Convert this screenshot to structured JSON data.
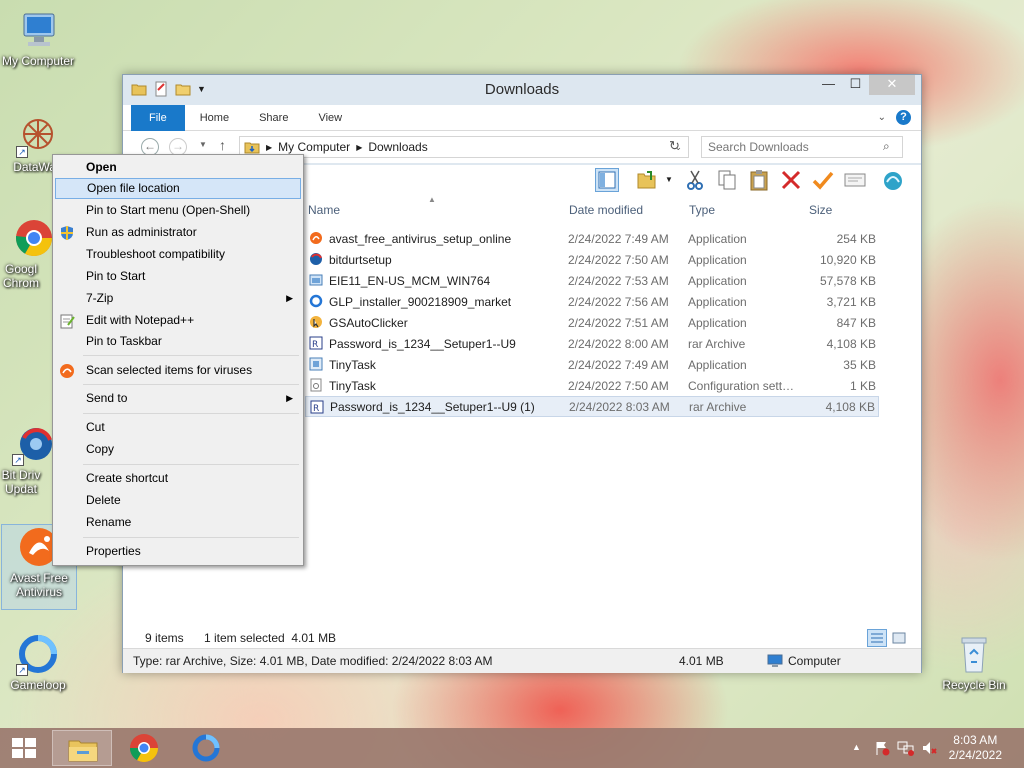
{
  "desktop": {
    "icons": [
      {
        "label": "My Computer"
      },
      {
        "label": "DataWag"
      },
      {
        "label": "Googl Chrom"
      },
      {
        "label": "Bit Driv Updat"
      },
      {
        "label": "Avast Free Antivirus"
      },
      {
        "label": "Gameloop"
      },
      {
        "label": "Recycle Bin"
      }
    ]
  },
  "window": {
    "title": "Downloads",
    "ribbon_tabs": [
      "File",
      "Home",
      "Share",
      "View"
    ],
    "address": {
      "crumbs": [
        "My Computer",
        "Downloads"
      ]
    },
    "search_placeholder": "Search Downloads",
    "columns": {
      "name": "Name",
      "date": "Date modified",
      "type": "Type",
      "size": "Size"
    },
    "files": [
      {
        "name": "avast_free_antivirus_setup_online",
        "date": "2/24/2022 7:49 AM",
        "type": "Application",
        "size": "254 KB"
      },
      {
        "name": "bitdurtsetup",
        "date": "2/24/2022 7:50 AM",
        "type": "Application",
        "size": "10,920 KB"
      },
      {
        "name": "EIE11_EN-US_MCM_WIN764",
        "date": "2/24/2022 7:53 AM",
        "type": "Application",
        "size": "57,578 KB"
      },
      {
        "name": "GLP_installer_900218909_market",
        "date": "2/24/2022 7:56 AM",
        "type": "Application",
        "size": "3,721 KB"
      },
      {
        "name": "GSAutoClicker",
        "date": "2/24/2022 7:51 AM",
        "type": "Application",
        "size": "847 KB"
      },
      {
        "name": "Password_is_1234__Setuper1--U9",
        "date": "2/24/2022 8:00 AM",
        "type": "rar Archive",
        "size": "4,108 KB"
      },
      {
        "name": "TinyTask",
        "date": "2/24/2022 7:49 AM",
        "type": "Application",
        "size": "35 KB"
      },
      {
        "name": "TinyTask",
        "date": "2/24/2022 7:50 AM",
        "type": "Configuration sett…",
        "size": "1 KB"
      },
      {
        "name": "Password_is_1234__Setuper1--U9 (1)",
        "date": "2/24/2022 8:03 AM",
        "type": "rar Archive",
        "size": "4,108 KB"
      }
    ],
    "status": {
      "item_count": "9 items",
      "selection": "1 item selected  4.01 MB",
      "details": "Type: rar Archive, Size: 4.01 MB, Date modified: 2/24/2022 8:03 AM",
      "size": "4.01 MB",
      "location": "Computer"
    }
  },
  "context_menu": {
    "items": [
      {
        "label": "Open"
      },
      {
        "label": "Open file location"
      },
      {
        "label": "Pin to Start menu (Open-Shell)"
      },
      {
        "label": "Run as administrator"
      },
      {
        "label": "Troubleshoot compatibility"
      },
      {
        "label": "Pin to Start"
      },
      {
        "label": "7-Zip"
      },
      {
        "label": "Edit with Notepad++"
      },
      {
        "label": "Pin to Taskbar"
      },
      {
        "label": "Scan selected items for viruses"
      },
      {
        "label": "Send to"
      },
      {
        "label": "Cut"
      },
      {
        "label": "Copy"
      },
      {
        "label": "Create shortcut"
      },
      {
        "label": "Delete"
      },
      {
        "label": "Rename"
      },
      {
        "label": "Properties"
      }
    ]
  },
  "taskbar": {
    "time": "8:03 AM",
    "date": "2/24/2022"
  }
}
